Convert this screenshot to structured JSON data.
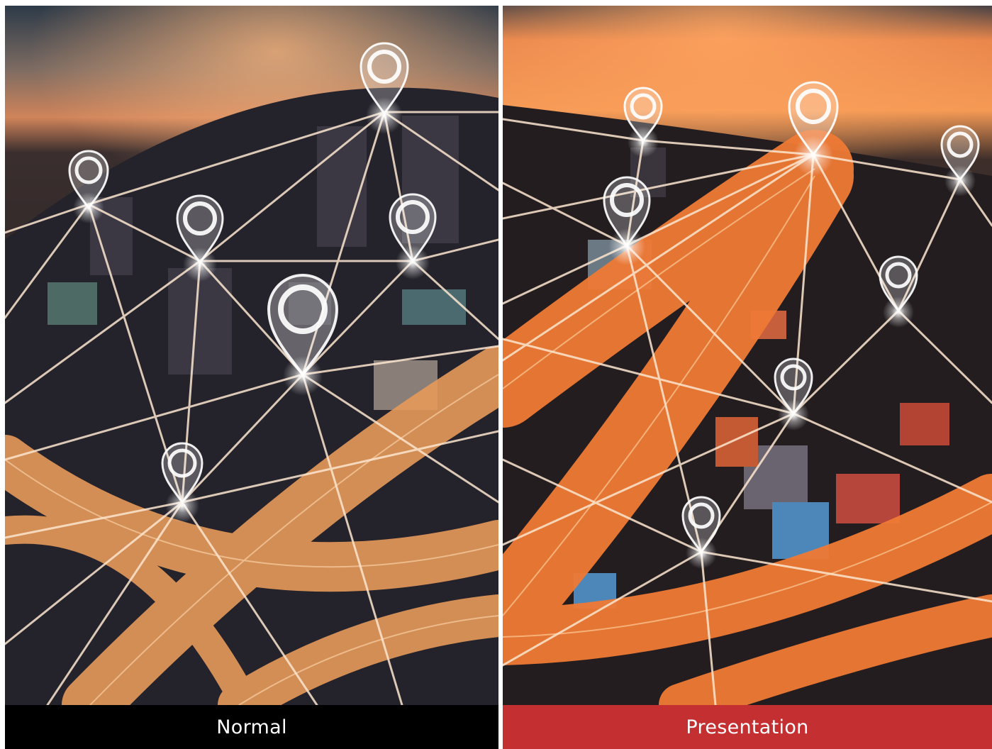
{
  "panels": {
    "left": {
      "caption": "Normal",
      "caption_bg": "#000000",
      "tone": "normal"
    },
    "right": {
      "caption": "Presentation",
      "caption_bg": "#c42f31",
      "tone": "vivid"
    }
  },
  "scene": {
    "subject": "fisheye aerial city at dusk with highways and glowing location-pin network",
    "pin_icon": "map-pin-icon"
  },
  "colors": {
    "sky_top": "#2f3c4a",
    "sky_glow": "#f08a4b",
    "ground": "#1d1c22",
    "road_light": "#f4a463",
    "network_line": "#fde6cf",
    "pin": "#ffffff"
  }
}
